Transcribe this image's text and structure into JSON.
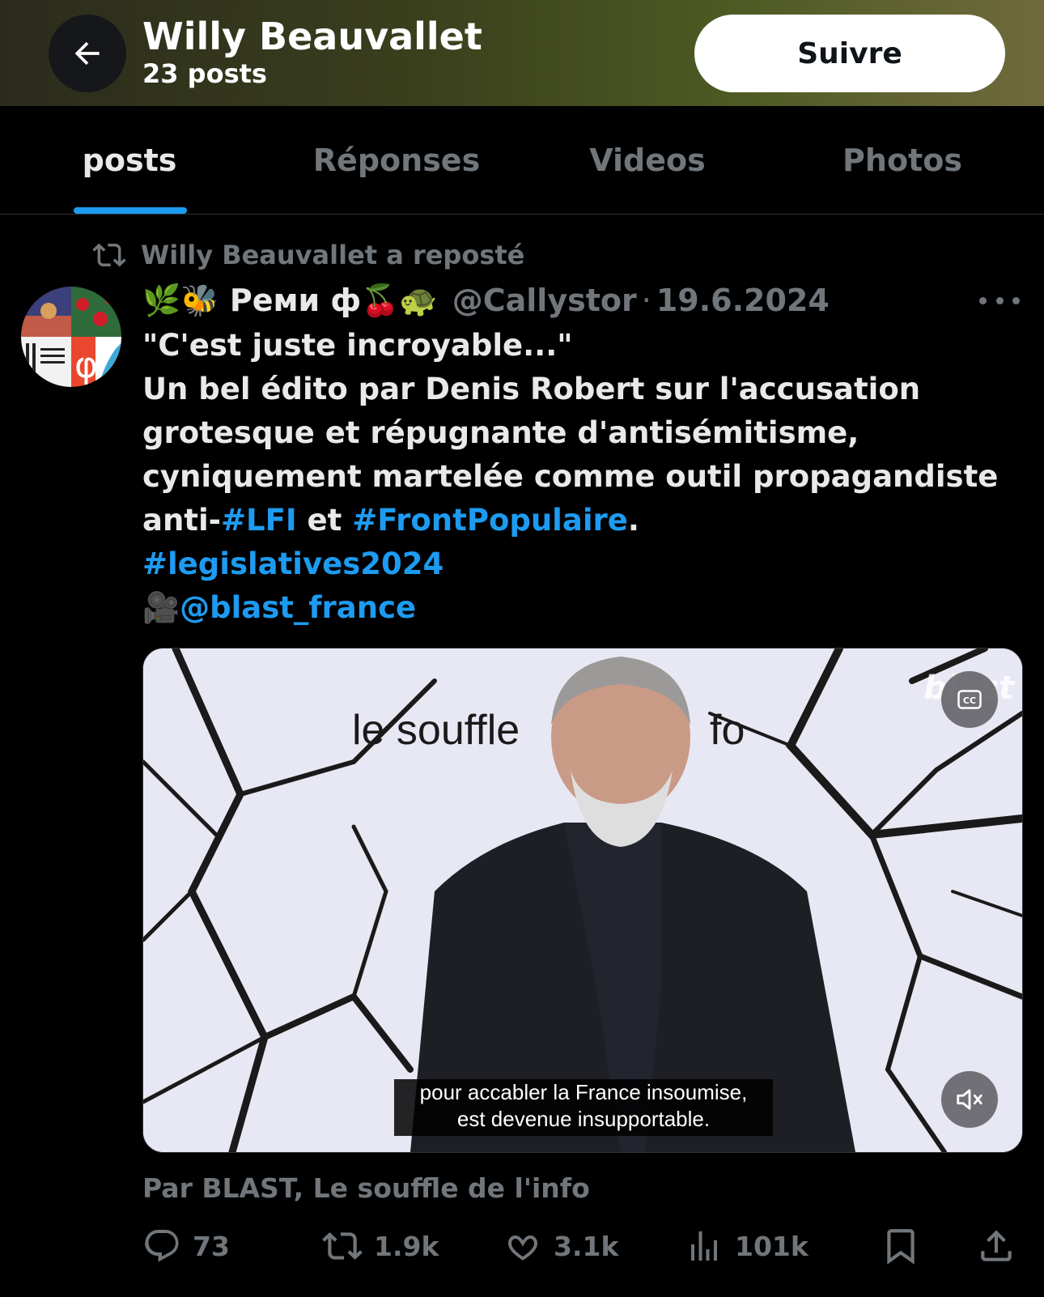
{
  "header": {
    "title": "Willy Beauvallet",
    "subtitle": "23 posts",
    "follow_label": "Suivre"
  },
  "tabs": [
    {
      "label": "posts",
      "active": true
    },
    {
      "label": "Réponses",
      "active": false
    },
    {
      "label": "Videos",
      "active": false
    },
    {
      "label": "Photos",
      "active": false
    }
  ],
  "repost": {
    "text": "Willy Beauvallet a reposté"
  },
  "tweet": {
    "display_name": "🌿🐝 Реми ф🍒🐢",
    "handle": "@Callystor",
    "separator": "·",
    "date": "19.6.2024",
    "line1": "\"C'est juste incroyable...\"",
    "line2": "Un bel édito par Denis Robert sur l'accusation",
    "line3": "grotesque et répugnante d'antisémitisme,",
    "line4": "cyniquement martelée comme outil propagandiste",
    "line5_pre": "anti-",
    "hashtag_lfi": "#LFI",
    "line5_mid": " et ",
    "hashtag_fp": "#FrontPopulaire",
    "line5_end": ".",
    "hashtag_leg": "#legislatives2024",
    "camera_emoji": "🎥",
    "mention": "@blast_france"
  },
  "media": {
    "background_text": "le souffle de l'info",
    "watermark": "blast",
    "caption_line1": "pour accabler la France insoumise,",
    "caption_line2": "est devenue insupportable.",
    "cc_label": "CC"
  },
  "source": "Par BLAST, Le souffle de l'info",
  "actions": {
    "replies": "73",
    "reposts": "1.9k",
    "likes": "3.1k",
    "views": "101k"
  },
  "colors": {
    "accent": "#1d9bf0",
    "muted": "#71767b",
    "text": "#e7e9ea",
    "background": "#000000"
  }
}
